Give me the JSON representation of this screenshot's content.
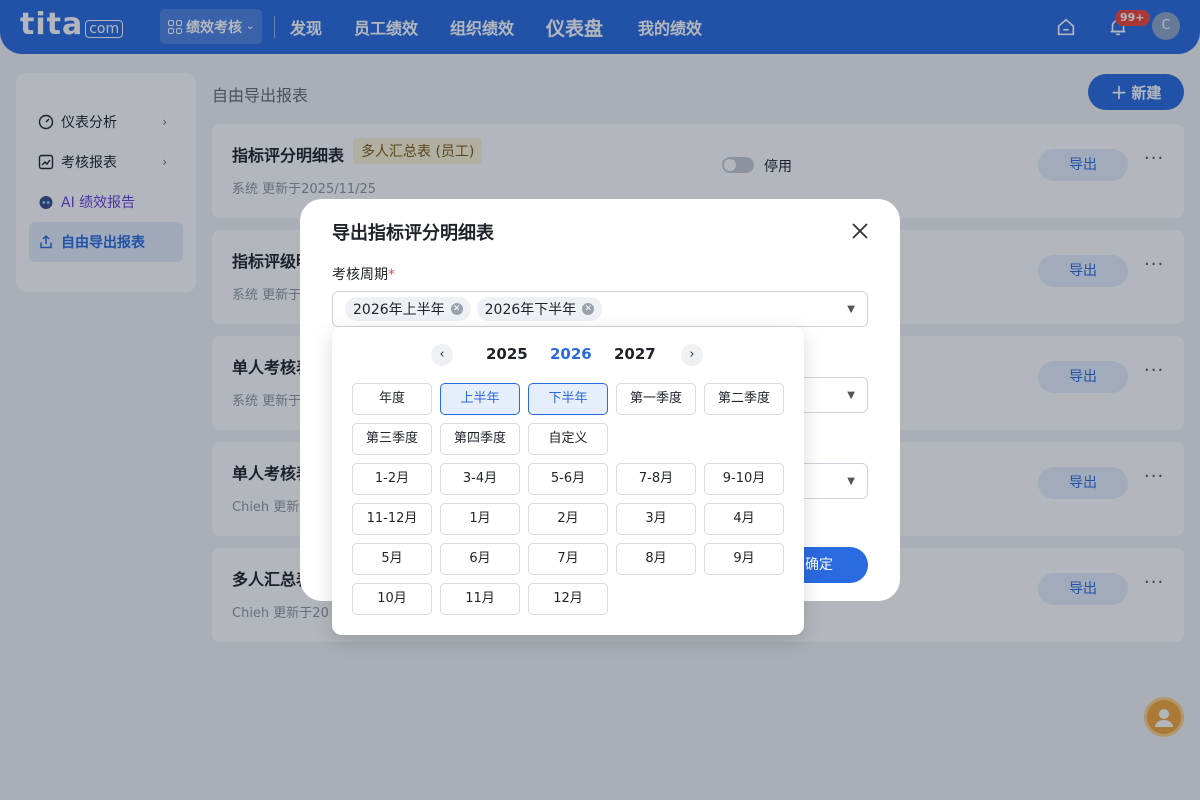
{
  "brand": {
    "logo_main": "tita",
    "logo_suffix": "com"
  },
  "topbar": {
    "module": "绩效考核",
    "nav": [
      "发现",
      "员工绩效",
      "组织绩效",
      "仪表盘",
      "我的绩效"
    ],
    "notifications": "99+",
    "avatar_initial": "C"
  },
  "sidebar": {
    "items": [
      {
        "label": "仪表分析"
      },
      {
        "label": "考核报表"
      },
      {
        "label": "AI 绩效报告"
      },
      {
        "label": "自由导出报表"
      }
    ]
  },
  "main": {
    "title": "自由导出报表",
    "new_button": "新建",
    "cards": [
      {
        "title": "指标评分明细表",
        "tag": "多人汇总表 (员工)",
        "subtitle": "系统 更新于2025/11/25",
        "toggle_label": "停用",
        "export": "导出",
        "more": "···"
      },
      {
        "title": "指标评级明",
        "subtitle": "系统 更新于",
        "export": "导出",
        "more": "···"
      },
      {
        "title": "单人考核表",
        "subtitle": "系统 更新于",
        "export": "导出",
        "more": "···"
      },
      {
        "title": "单人考核表",
        "subtitle": "Chieh 更新",
        "export": "导出",
        "more": "···"
      },
      {
        "title": "多人汇总表",
        "subtitle": "Chieh 更新于20",
        "export": "导出",
        "more": "···"
      }
    ]
  },
  "modal": {
    "title": "导出指标评分明细表",
    "field_label": "考核周期",
    "required_mark": "*",
    "chips": [
      "2026年上半年",
      "2026年下半年"
    ],
    "confirm": "确定"
  },
  "picker": {
    "years": [
      "2025",
      "2026",
      "2027"
    ],
    "selected_year": "2026",
    "options": [
      "年度",
      "上半年",
      "下半年",
      "第一季度",
      "第二季度",
      "第三季度",
      "第四季度",
      "自定义",
      "1-2月",
      "3-4月",
      "5-6月",
      "7-8月",
      "9-10月",
      "11-12月",
      "1月",
      "2月",
      "3月",
      "4月",
      "5月",
      "6月",
      "7月",
      "8月",
      "9月",
      "10月",
      "11月",
      "12月"
    ],
    "selected_options": [
      "上半年",
      "下半年"
    ]
  },
  "colors": {
    "primary": "#2a6ae0",
    "tag_bg": "#fdf3d6",
    "danger": "#e5484d"
  }
}
